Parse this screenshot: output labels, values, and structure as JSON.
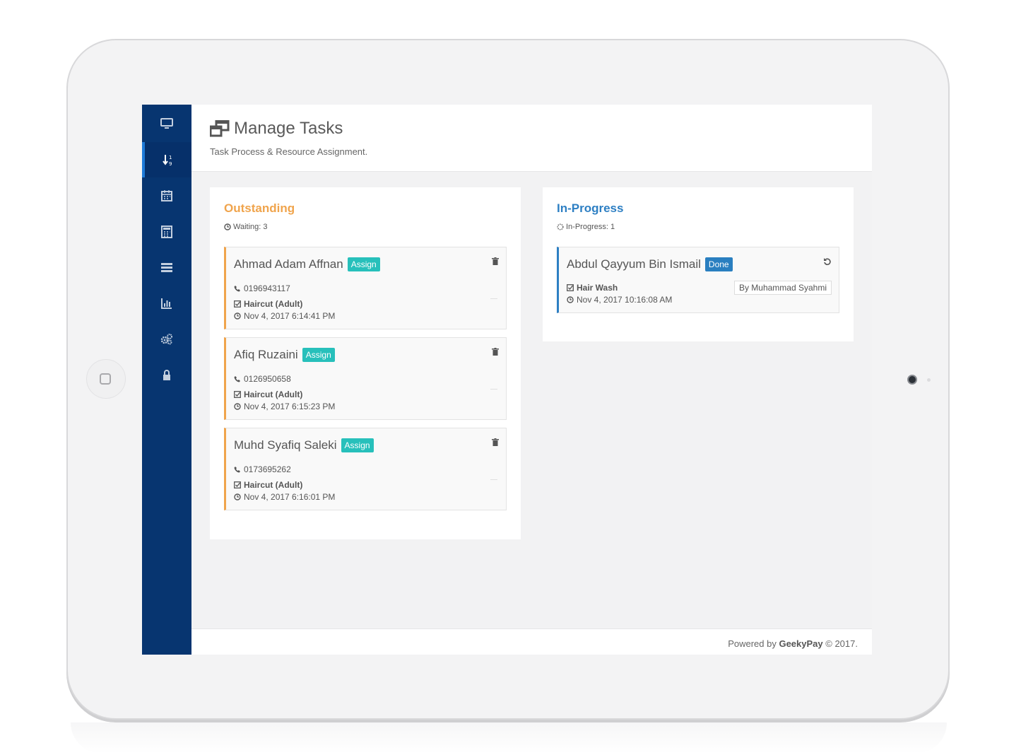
{
  "sidebar": {
    "items": [
      {
        "icon": "monitor-icon"
      },
      {
        "icon": "sort-numeric-icon",
        "active": true
      },
      {
        "icon": "calendar-icon"
      },
      {
        "icon": "calculator-icon"
      },
      {
        "icon": "server-icon"
      },
      {
        "icon": "bar-chart-icon"
      },
      {
        "icon": "gears-icon"
      },
      {
        "icon": "lock-icon"
      }
    ]
  },
  "header": {
    "title": "Manage Tasks",
    "subtitle": "Task Process & Resource Assignment."
  },
  "outstanding": {
    "title": "Outstanding",
    "title_color": "#f0a44c",
    "count_label": "Waiting: 3",
    "cards": [
      {
        "name": "Ahmad Adam Affnan",
        "badge": "Assign",
        "phone": "0196943117",
        "service": "Haircut (Adult)",
        "time": "Nov 4, 2017 6:14:41 PM"
      },
      {
        "name": "Afiq Ruzaini",
        "badge": "Assign",
        "phone": "0126950658",
        "service": "Haircut (Adult)",
        "time": "Nov 4, 2017 6:15:23 PM"
      },
      {
        "name": "Muhd Syafiq Saleki",
        "badge": "Assign",
        "phone": "0173695262",
        "service": "Haircut (Adult)",
        "time": "Nov 4, 2017 6:16:01 PM"
      }
    ]
  },
  "in_progress": {
    "title": "In-Progress",
    "title_color": "#2d7fc3",
    "count_label": "In-Progress: 1",
    "cards": [
      {
        "name": "Abdul Qayyum Bin Ismail",
        "badge": "Done",
        "service": "Hair Wash",
        "time": "Nov 4, 2017 10:16:08 AM",
        "by": "By Muhammad Syahmi"
      }
    ]
  },
  "footer": {
    "prefix": "Powered by",
    "brand": "GeekyPay",
    "suffix": "© 2017."
  }
}
